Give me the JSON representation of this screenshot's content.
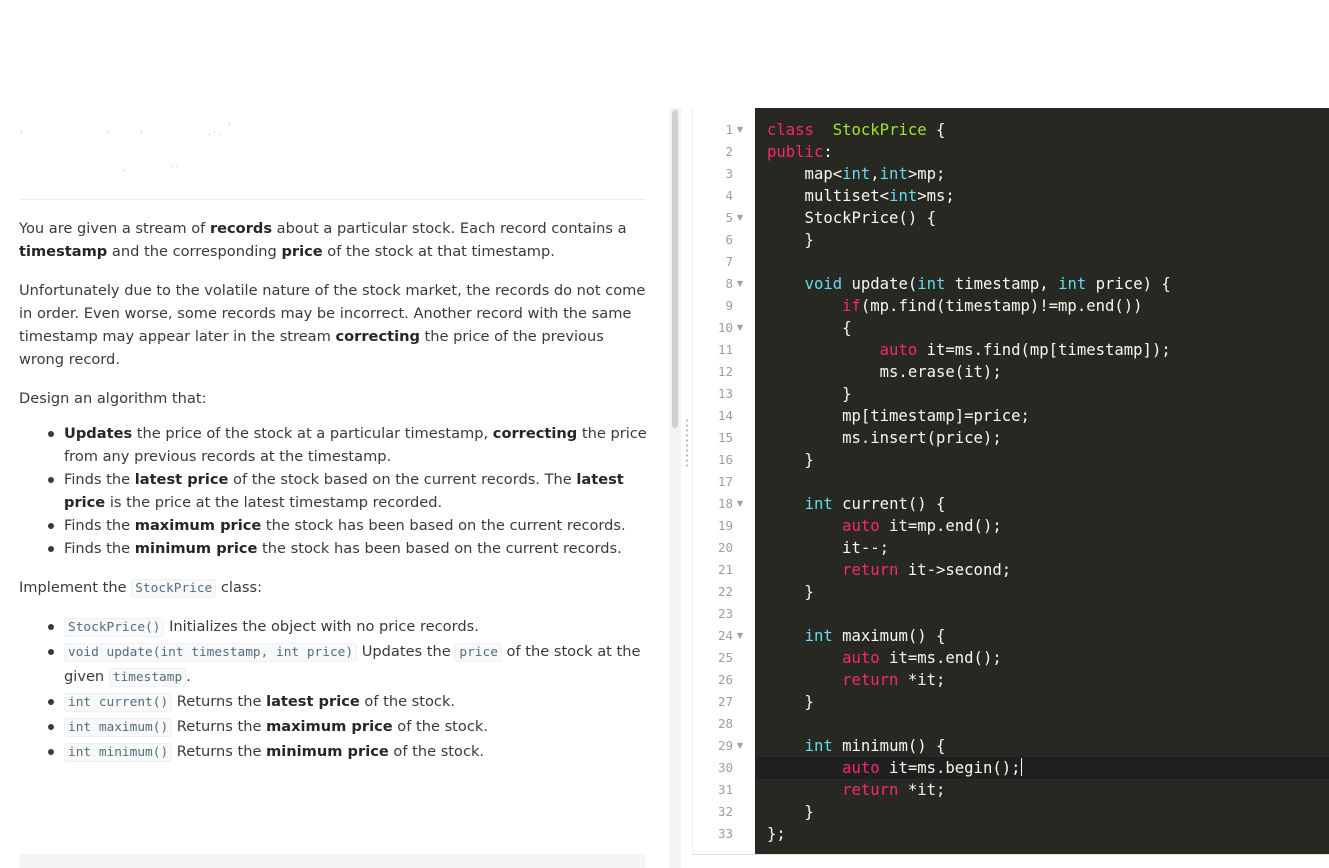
{
  "description": {
    "intro": {
      "t1": "You are given a stream of ",
      "b1": "records",
      "t2": " about a particular stock. Each record contains a ",
      "b2": "timestamp",
      "t3": " and the corresponding ",
      "b3": "price",
      "t4": " of the stock at that timestamp."
    },
    "para2": {
      "t1": "Unfortunately due to the volatile nature of the stock market, the records do not come in order. Even worse, some records may be incorrect. Another record with the same timestamp may appear later in the stream ",
      "b1": "correcting",
      "t2": " the price of the previous wrong record."
    },
    "design_intro": "Design an algorithm that:",
    "design_items": [
      {
        "b1": "Updates",
        "t1": " the price of the stock at a particular timestamp, ",
        "b2": "correcting",
        "t2": " the price from any previous records at the timestamp."
      },
      {
        "t0": "Finds the ",
        "b1": "latest price",
        "t1": " of the stock based on the current records. The ",
        "b2": "latest price",
        "t2": " is the price at the latest timestamp recorded."
      },
      {
        "t0": "Finds the ",
        "b1": "maximum price",
        "t1": " the stock has been based on the current records."
      },
      {
        "t0": "Finds the ",
        "b1": "minimum price",
        "t1": " the stock has been based on the current records."
      }
    ],
    "implement": {
      "t1": "Implement the ",
      "c1": "StockPrice",
      "t2": " class:"
    },
    "impl_items": [
      {
        "c1": "StockPrice()",
        "t1": " Initializes the object with no price records."
      },
      {
        "c1": "void update(int timestamp, int price)",
        "t1": " Updates the ",
        "c2": "price",
        "t2": " of the stock at the given ",
        "c3": "timestamp",
        "t3": "."
      },
      {
        "c1": "int current()",
        "t1": " Returns the ",
        "b1": "latest price",
        "t2": " of the stock."
      },
      {
        "c1": "int maximum()",
        "t1": " Returns the ",
        "b1": "maximum price",
        "t2": " of the stock."
      },
      {
        "c1": "int minimum()",
        "t1": " Returns the ",
        "b1": "minimum price",
        "t2": " of the stock."
      }
    ]
  },
  "editor": {
    "line_numbers": [
      "1",
      "2",
      "3",
      "4",
      "5",
      "6",
      "7",
      "8",
      "9",
      "10",
      "11",
      "12",
      "13",
      "14",
      "15",
      "16",
      "17",
      "18",
      "19",
      "20",
      "21",
      "22",
      "23",
      "24",
      "25",
      "26",
      "27",
      "28",
      "29",
      "30",
      "31",
      "32",
      "33"
    ],
    "fold_lines": [
      "1",
      "5",
      "8",
      "10",
      "18",
      "24",
      "29"
    ],
    "fold_marker": "▼",
    "lines": [
      [
        [
          "kw",
          "class"
        ],
        [
          "",
          "  "
        ],
        [
          "cls",
          "StockPrice"
        ],
        [
          "",
          " {"
        ]
      ],
      [
        [
          "kw",
          "public"
        ],
        [
          "",
          ":"
        ]
      ],
      [
        [
          "",
          "    map<"
        ],
        [
          "ty",
          "int"
        ],
        [
          "",
          ","
        ],
        [
          "ty",
          "int"
        ],
        [
          "",
          ">mp;"
        ]
      ],
      [
        [
          "",
          "    multiset<"
        ],
        [
          "ty",
          "int"
        ],
        [
          "",
          ">ms;"
        ]
      ],
      [
        [
          "",
          "    StockPrice() {"
        ]
      ],
      [
        [
          "",
          "    }"
        ]
      ],
      [
        [
          "",
          ""
        ]
      ],
      [
        [
          "",
          "    "
        ],
        [
          "ty",
          "void"
        ],
        [
          "",
          " update("
        ],
        [
          "ty",
          "int"
        ],
        [
          "",
          " timestamp, "
        ],
        [
          "ty",
          "int"
        ],
        [
          "",
          " price) {"
        ]
      ],
      [
        [
          "",
          "        "
        ],
        [
          "kw",
          "if"
        ],
        [
          "",
          "(mp.find(timestamp)!=mp.end())"
        ]
      ],
      [
        [
          "",
          "        {"
        ]
      ],
      [
        [
          "",
          "            "
        ],
        [
          "kw",
          "auto"
        ],
        [
          "",
          " it=ms.find(mp[timestamp]);"
        ]
      ],
      [
        [
          "",
          "            ms.erase(it);"
        ]
      ],
      [
        [
          "",
          "        }"
        ]
      ],
      [
        [
          "",
          "        mp[timestamp]=price;"
        ]
      ],
      [
        [
          "",
          "        ms.insert(price);"
        ]
      ],
      [
        [
          "",
          "    }"
        ]
      ],
      [
        [
          "",
          ""
        ]
      ],
      [
        [
          "",
          "    "
        ],
        [
          "ty",
          "int"
        ],
        [
          "",
          " current() {"
        ]
      ],
      [
        [
          "",
          "        "
        ],
        [
          "kw",
          "auto"
        ],
        [
          "",
          " it=mp.end();"
        ]
      ],
      [
        [
          "",
          "        it--;"
        ]
      ],
      [
        [
          "",
          "        "
        ],
        [
          "kw",
          "return"
        ],
        [
          "",
          " it->second;"
        ]
      ],
      [
        [
          "",
          "    }"
        ]
      ],
      [
        [
          "",
          ""
        ]
      ],
      [
        [
          "",
          "    "
        ],
        [
          "ty",
          "int"
        ],
        [
          "",
          " maximum() {"
        ]
      ],
      [
        [
          "",
          "        "
        ],
        [
          "kw",
          "auto"
        ],
        [
          "",
          " it=ms.end();"
        ]
      ],
      [
        [
          "",
          "        "
        ],
        [
          "kw",
          "return"
        ],
        [
          "",
          " *it;"
        ]
      ],
      [
        [
          "",
          "    }"
        ]
      ],
      [
        [
          "",
          ""
        ]
      ],
      [
        [
          "",
          "    "
        ],
        [
          "ty",
          "int"
        ],
        [
          "",
          " minimum() {"
        ]
      ],
      [
        [
          "",
          "        "
        ],
        [
          "kw",
          "auto"
        ],
        [
          "",
          " it=ms.begin();"
        ]
      ],
      [
        [
          "",
          "        "
        ],
        [
          "kw",
          "return"
        ],
        [
          "",
          " *it;"
        ]
      ],
      [
        [
          "",
          "    }"
        ]
      ],
      [
        [
          "",
          "};"
        ]
      ]
    ],
    "cursor_line": "30"
  }
}
